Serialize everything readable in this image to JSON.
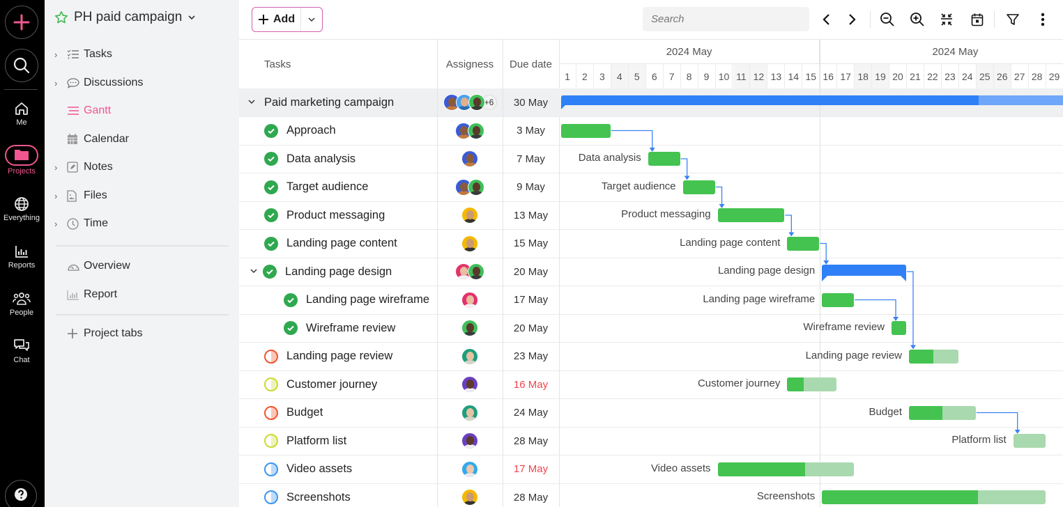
{
  "rail": {
    "items": [
      {
        "label": "Me",
        "icon": "home-icon"
      },
      {
        "label": "Projects",
        "icon": "folder-icon",
        "active": true
      },
      {
        "label": "Everything",
        "icon": "globe-icon"
      },
      {
        "label": "Reports",
        "icon": "bar-chart-icon"
      },
      {
        "label": "People",
        "icon": "people-icon"
      },
      {
        "label": "Chat",
        "icon": "chat-icon"
      }
    ]
  },
  "sidebar": {
    "project_title": "PH paid campaign",
    "items": [
      {
        "label": "Tasks",
        "icon": "tasks-icon",
        "expandable": true
      },
      {
        "label": "Discussions",
        "icon": "discussion-icon",
        "expandable": true
      },
      {
        "label": "Gantt",
        "icon": "gantt-icon",
        "active": true
      },
      {
        "label": "Calendar",
        "icon": "calendar-icon"
      },
      {
        "label": "Notes",
        "icon": "notes-icon",
        "expandable": true
      },
      {
        "label": "Files",
        "icon": "files-icon",
        "expandable": true
      },
      {
        "label": "Time",
        "icon": "clock-icon",
        "expandable": true
      },
      {
        "label": "Overview",
        "icon": "gauge-icon"
      },
      {
        "label": "Report",
        "icon": "report-icon"
      },
      {
        "label": "Project tabs",
        "icon": "plus-icon"
      }
    ]
  },
  "toolbar": {
    "add_label": "Add",
    "search_placeholder": "Search"
  },
  "table": {
    "headers": {
      "tasks": "Tasks",
      "assignees": "Assigness",
      "due": "Due date"
    },
    "rows": [
      {
        "name": "Paid marketing campaign",
        "type": "project",
        "expanded": true,
        "avatars": [
          "a1",
          "a2",
          "a3"
        ],
        "more": "+6",
        "due": "30 May",
        "overdue": false
      },
      {
        "name": "Approach",
        "status": "done",
        "avatars": [
          "a1",
          "a3"
        ],
        "due": "3 May",
        "overdue": false,
        "level": 1
      },
      {
        "name": "Data analysis",
        "status": "done",
        "avatars": [
          "a1"
        ],
        "due": "7 May",
        "overdue": false,
        "level": 1
      },
      {
        "name": "Target audience",
        "status": "done",
        "avatars": [
          "a1",
          "a3"
        ],
        "due": "9 May",
        "overdue": false,
        "level": 1
      },
      {
        "name": "Product messaging",
        "status": "done",
        "avatars": [
          "a4"
        ],
        "due": "13 May",
        "overdue": false,
        "level": 1
      },
      {
        "name": "Landing page content",
        "status": "done",
        "avatars": [
          "a4"
        ],
        "due": "15 May",
        "overdue": false,
        "level": 1
      },
      {
        "name": "Landing page design",
        "status": "done",
        "type": "group",
        "expanded": true,
        "avatars": [
          "a5",
          "a3"
        ],
        "due": "20 May",
        "overdue": false,
        "level": 1
      },
      {
        "name": "Landing page wireframe",
        "status": "done",
        "avatars": [
          "a5"
        ],
        "due": "17 May",
        "overdue": false,
        "level": 2
      },
      {
        "name": "Wireframe review",
        "status": "done",
        "avatars": [
          "a3"
        ],
        "due": "20 May",
        "overdue": false,
        "level": 2
      },
      {
        "name": "Landing page review",
        "status": "in-progress-orange",
        "avatars": [
          "a6"
        ],
        "due": "23 May",
        "overdue": false,
        "level": 1
      },
      {
        "name": "Customer journey",
        "status": "in-progress-lime",
        "avatars": [
          "a7"
        ],
        "due": "16 May",
        "overdue": true,
        "level": 1
      },
      {
        "name": "Budget",
        "status": "in-progress-orange",
        "avatars": [
          "a6"
        ],
        "due": "24 May",
        "overdue": false,
        "level": 1
      },
      {
        "name": "Platform list",
        "status": "in-progress-lime",
        "avatars": [
          "a7"
        ],
        "due": "28 May",
        "overdue": false,
        "level": 1
      },
      {
        "name": "Video assets",
        "status": "in-progress-blue",
        "avatars": [
          "a8"
        ],
        "due": "17 May",
        "overdue": true,
        "level": 1
      },
      {
        "name": "Screenshots",
        "status": "in-progress-blue",
        "avatars": [
          "a4"
        ],
        "due": "28 May",
        "overdue": false,
        "level": 1
      }
    ]
  },
  "avatars": {
    "a1": {
      "bg": "#3b5bd6",
      "skin": "#8a5a3c",
      "shirt": "#c27a3a"
    },
    "a2": {
      "bg": "#4aa3f0",
      "skin": "#e2b08a",
      "shirt": "#2b6cb0"
    },
    "a3": {
      "bg": "#3fbf5a",
      "skin": "#5a3a2a",
      "shirt": "#3a3a3a"
    },
    "a4": {
      "bg": "#f5b800",
      "skin": "#c99a74",
      "shirt": "#333333"
    },
    "a5": {
      "bg": "#e2336b",
      "skin": "#e8c0a0",
      "shirt": "#f1f1f1"
    },
    "a6": {
      "bg": "#1e9e7e",
      "skin": "#e6c2a4",
      "shirt": "#d8d3c8"
    },
    "a7": {
      "bg": "#6b3fc2",
      "skin": "#5c3b28",
      "shirt": "#f0f0f0"
    },
    "a8": {
      "bg": "#33a9ee",
      "skin": "#f0c8a8",
      "shirt": "#eaeaea"
    }
  },
  "status_colors": {
    "done": "#2fa84f",
    "in-progress-orange": "#f2542d",
    "in-progress-lime": "#c9db2e",
    "in-progress-blue": "#3b96f0"
  },
  "colors": {
    "accent": "#f0568f",
    "bar_done": "#44c350",
    "bar_remaining": "#a9d9ae",
    "summary": "#2f80f6",
    "link": "#3b82f6",
    "overdue": "#f0454f"
  },
  "gantt": {
    "months": [
      {
        "label": "2024 May",
        "from_day": 1,
        "to_day": 15
      },
      {
        "label": "2024 May",
        "from_day": 16,
        "to_day": 29
      }
    ],
    "days": [
      1,
      2,
      3,
      4,
      5,
      6,
      7,
      8,
      9,
      10,
      11,
      12,
      13,
      14,
      15,
      16,
      17,
      18,
      19,
      20,
      21,
      22,
      23,
      24,
      25,
      26,
      27,
      28,
      29
    ],
    "weekend_days": [
      4,
      5,
      11,
      12,
      18,
      19,
      25,
      26
    ],
    "bars": [
      {
        "row": 0,
        "kind": "summary",
        "start": 1,
        "end": 30,
        "progress_end": 25
      },
      {
        "row": 1,
        "label": "",
        "start": 1,
        "end": 3,
        "progress": 1.0
      },
      {
        "row": 2,
        "label": "Data analysis",
        "start": 6,
        "end": 7,
        "progress": 1.0
      },
      {
        "row": 3,
        "label": "Target audience",
        "start": 8,
        "end": 9,
        "progress": 1.0
      },
      {
        "row": 4,
        "label": "Product messaging",
        "start": 10,
        "end": 13,
        "progress": 1.0
      },
      {
        "row": 5,
        "label": "Landing page content",
        "start": 14,
        "end": 15,
        "progress": 1.0
      },
      {
        "row": 6,
        "label": "Landing page design",
        "kind": "group",
        "start": 16,
        "end": 20
      },
      {
        "row": 7,
        "label": "Landing page wireframe",
        "start": 16,
        "end": 17,
        "progress": 1.0
      },
      {
        "row": 8,
        "label": "Wireframe review",
        "start": 20,
        "end": 20,
        "progress": 1.0
      },
      {
        "row": 9,
        "label": "Landing page review",
        "start": 21,
        "end": 23,
        "progress": 0.5
      },
      {
        "row": 10,
        "label": "Customer journey",
        "start": 14,
        "end": 16,
        "progress": 0.33
      },
      {
        "row": 11,
        "label": "Budget",
        "start": 21,
        "end": 24,
        "progress": 0.5
      },
      {
        "row": 12,
        "label": "Platform list",
        "start": 27,
        "end": 28,
        "progress": 0.0
      },
      {
        "row": 13,
        "label": "Video assets",
        "start": 10,
        "end": 17,
        "progress": 0.64
      },
      {
        "row": 14,
        "label": "Screenshots",
        "start": 16,
        "end": 28,
        "progress": 0.7
      }
    ],
    "links": [
      [
        1,
        2
      ],
      [
        2,
        3
      ],
      [
        3,
        4
      ],
      [
        4,
        5
      ],
      [
        5,
        6
      ],
      [
        7,
        8
      ],
      [
        6,
        9
      ],
      [
        11,
        12
      ]
    ]
  }
}
